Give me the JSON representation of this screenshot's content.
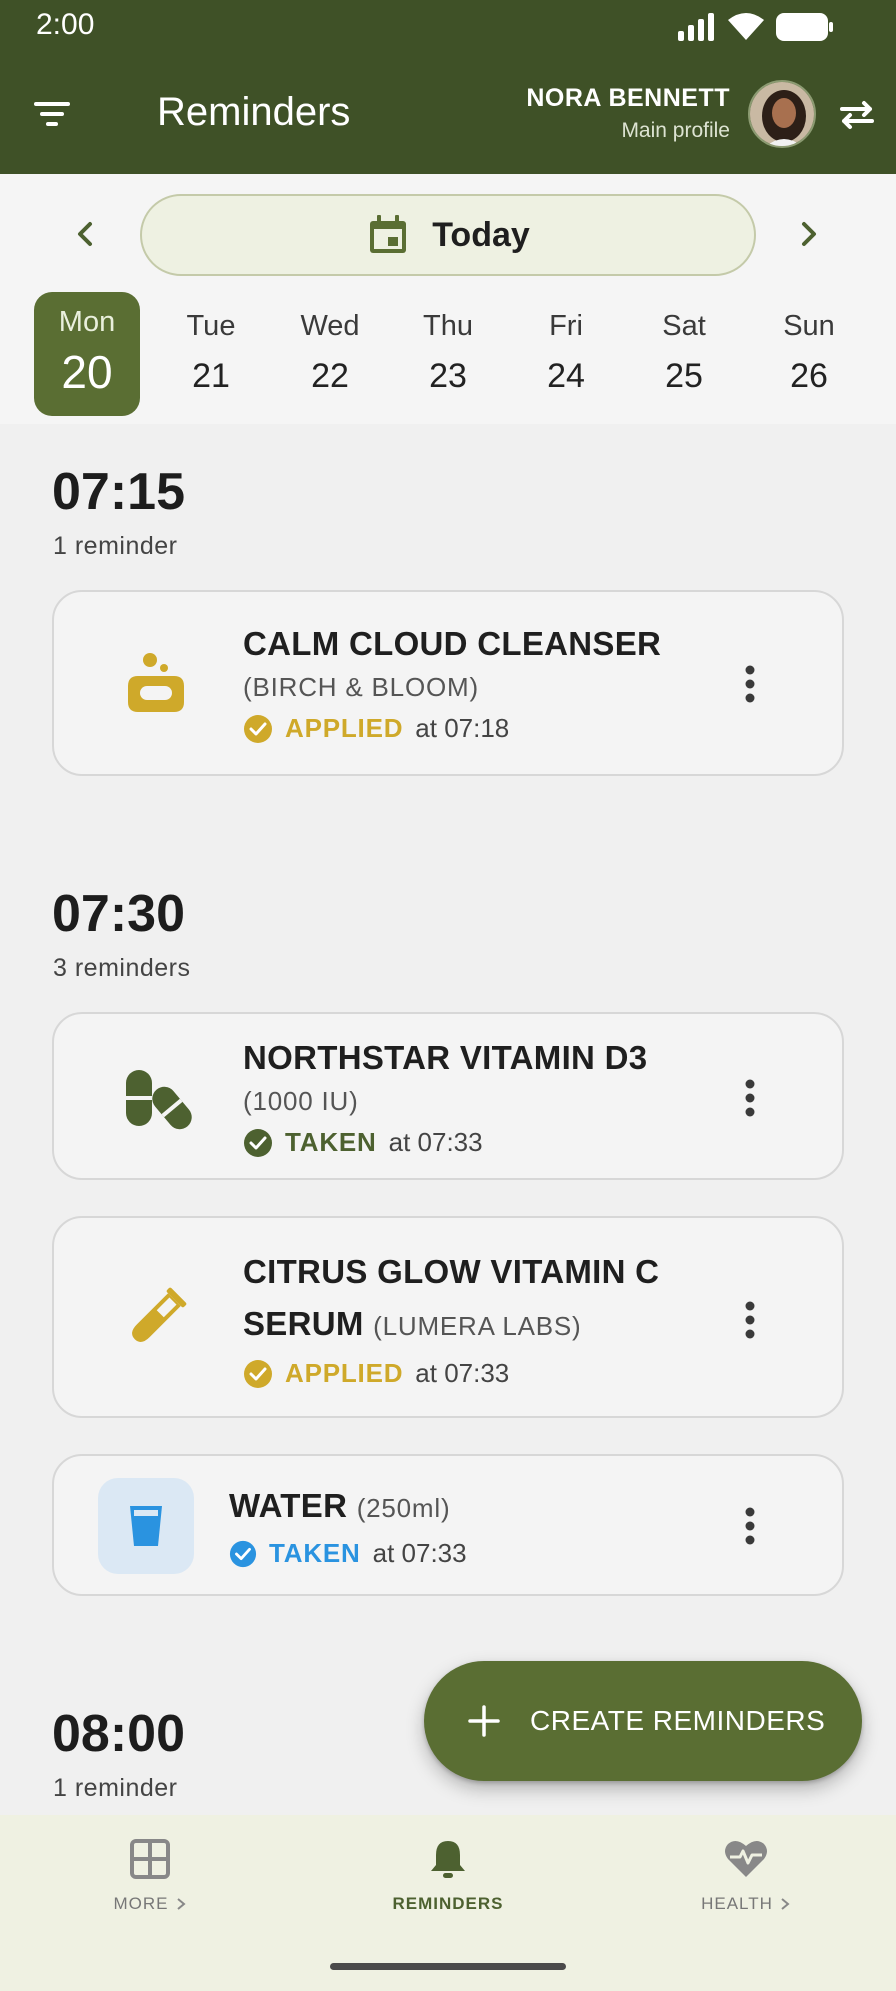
{
  "status_bar": {
    "time": "2:00"
  },
  "header": {
    "title": "Reminders",
    "profile_name": "NORA BENNETT",
    "profile_subtitle": "Main profile"
  },
  "date_nav": {
    "today_label": "Today",
    "days": [
      {
        "name": "Mon",
        "num": "20",
        "selected": true
      },
      {
        "name": "Tue",
        "num": "21"
      },
      {
        "name": "Wed",
        "num": "22"
      },
      {
        "name": "Thu",
        "num": "23"
      },
      {
        "name": "Fri",
        "num": "24"
      },
      {
        "name": "Sat",
        "num": "25"
      },
      {
        "name": "Sun",
        "num": "26"
      }
    ]
  },
  "groups": [
    {
      "time": "07:15",
      "count": "1 reminder",
      "items": [
        {
          "title": "CALM CLOUD CLEANSER",
          "subtitle": "(BIRCH & BLOOM)",
          "status": "APPLIED",
          "at": "at 07:18",
          "icon": "soap-icon",
          "status_color": "#cfa92a"
        }
      ]
    },
    {
      "time": "07:30",
      "count": "3 reminders",
      "items": [
        {
          "title": "NORTHSTAR VITAMIN D3",
          "subtitle": "(1000 IU)",
          "status": "TAKEN",
          "at": "at 07:33",
          "icon": "pill-icon",
          "status_color": "#4d6130"
        },
        {
          "title_line1": "CITRUS GLOW VITAMIN C",
          "title_line2": "SERUM",
          "subtitle": "(LUMERA LABS)",
          "status": "APPLIED",
          "at": "at 07:33",
          "icon": "test-tube-icon",
          "status_color": "#cfa92a"
        },
        {
          "title": "WATER",
          "subtitle": "(250ml)",
          "status": "TAKEN",
          "at": "at 07:33",
          "icon": "water-glass-icon",
          "status_color": "#2a93e0"
        }
      ]
    },
    {
      "time": "08:00",
      "count": "1 reminder"
    }
  ],
  "fab": {
    "label": "CREATE REMINDERS"
  },
  "bottom_nav": [
    {
      "label": "MORE",
      "icon": "grid-icon"
    },
    {
      "label": "REMINDERS",
      "icon": "bell-icon",
      "active": true
    },
    {
      "label": "HEALTH",
      "icon": "heart-pulse-icon"
    }
  ],
  "colors": {
    "primary": "#3f5127",
    "accent_green": "#5a6e33",
    "applied_yellow": "#cfa92a",
    "water_blue": "#2a93e0"
  }
}
